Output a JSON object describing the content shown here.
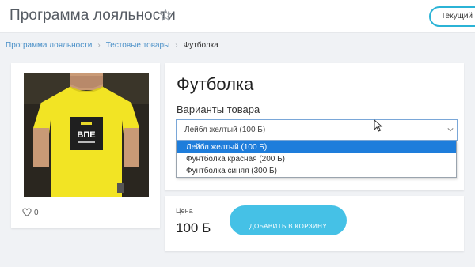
{
  "header": {
    "title": "Программа лояльности",
    "current_button": "Текущий с"
  },
  "breadcrumb": {
    "items": [
      "Программа лояльности",
      "Тестовые товары",
      "Футболка"
    ]
  },
  "product": {
    "name": "Футболка",
    "image_print_text": "ВПЕ",
    "likes": "0"
  },
  "variants": {
    "label": "Варианты товара",
    "selected": "Лейбл желтый (100 Б)",
    "options": [
      "Лейбл желтый (100 Б)",
      "Фунтболка красная (200 Б)",
      "Фунтболка синяя (300 Б)"
    ]
  },
  "purchase": {
    "price_label": "Цена",
    "price_value": "100 Б",
    "add_to_cart_label": "ДОБАВИТЬ В КОРЗИНУ"
  },
  "colors": {
    "accent": "#45c1e6",
    "header_button_border": "#2bb3d6",
    "link": "#4a90c8",
    "dropdown_highlight": "#1e7ddb",
    "shirt": "#f2e424"
  }
}
